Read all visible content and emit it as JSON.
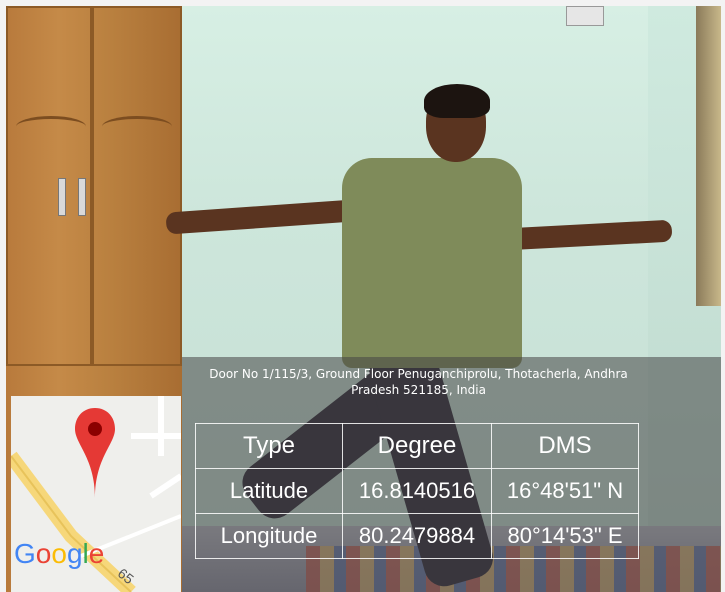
{
  "overlay": {
    "address": "Door No 1/115/3, Ground Floor Penuganchiprolu, Thotacherla, Andhra Pradesh 521185, India"
  },
  "coords_table": {
    "header": [
      "Type",
      "Degree",
      "DMS"
    ],
    "rows": [
      {
        "type": "Latitude",
        "degree": "16.8140516",
        "dms": "16°48'51\" N"
      },
      {
        "type": "Longitude",
        "degree": "80.2479884",
        "dms": "80°14'53\" E"
      }
    ]
  },
  "map": {
    "logo_text": "Google",
    "road_number": "65",
    "pin_icon": "map-pin-icon",
    "colors": {
      "pin": "#e53935",
      "road": "#f6d77a"
    }
  }
}
